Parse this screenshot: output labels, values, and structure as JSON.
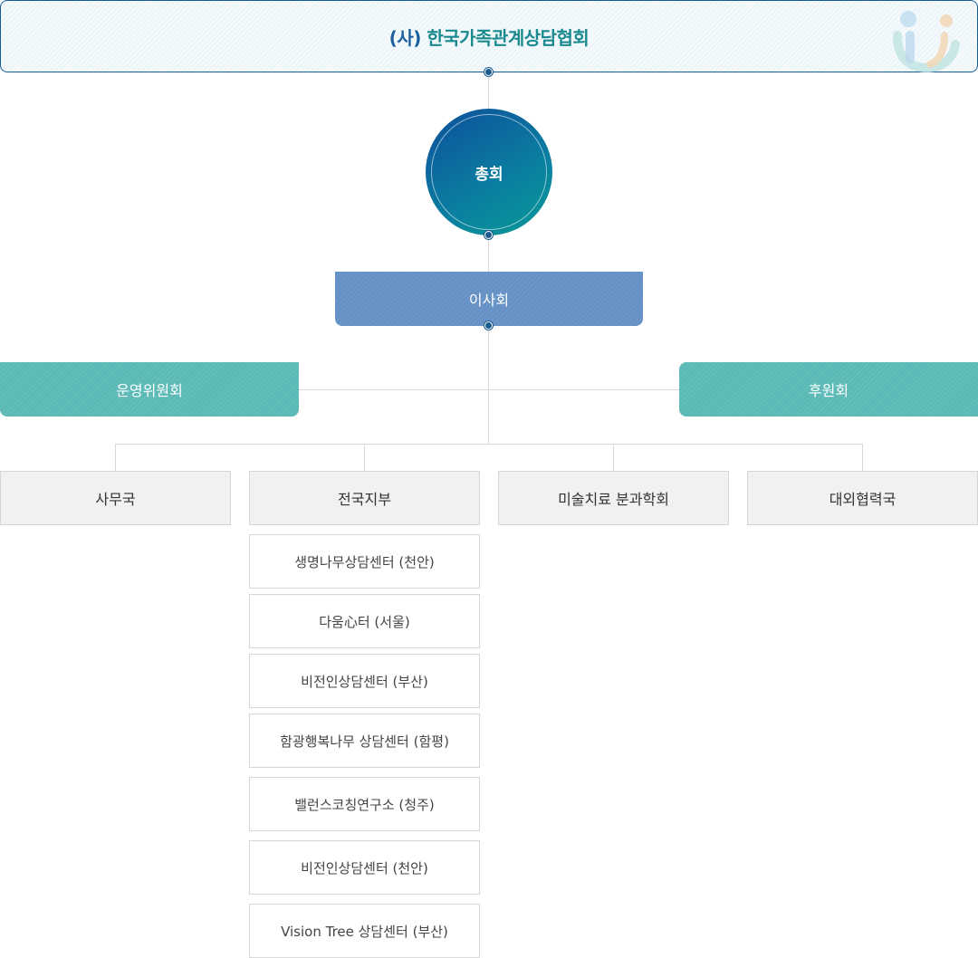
{
  "header": {
    "title_prefix": "(사)",
    "title_main": "한국가족관계상담협회"
  },
  "general_assembly": {
    "label": "총회"
  },
  "board": {
    "label": "이사회"
  },
  "committees": {
    "left": "운영위원회",
    "right": "후원회"
  },
  "departments": [
    {
      "label": "사무국"
    },
    {
      "label": "전국지부"
    },
    {
      "label": "미술치료 분과학회"
    },
    {
      "label": "대외협력국"
    }
  ],
  "branches": [
    {
      "label": "생명나무상담센터 (천안)"
    },
    {
      "label": "다움心터 (서울)"
    },
    {
      "label": "비전인상담센터 (부산)"
    },
    {
      "label": "함광행복나무 상담센터 (함평)"
    },
    {
      "label": "밸런스코칭연구소 (청주)"
    },
    {
      "label": "비전인상담센터 (천안)"
    },
    {
      "label": "Vision Tree 상담센터 (부산)"
    }
  ],
  "colors": {
    "primary_blue": "#1a5a8c",
    "teal": "#5bbab6",
    "board_blue": "#6591c5"
  }
}
